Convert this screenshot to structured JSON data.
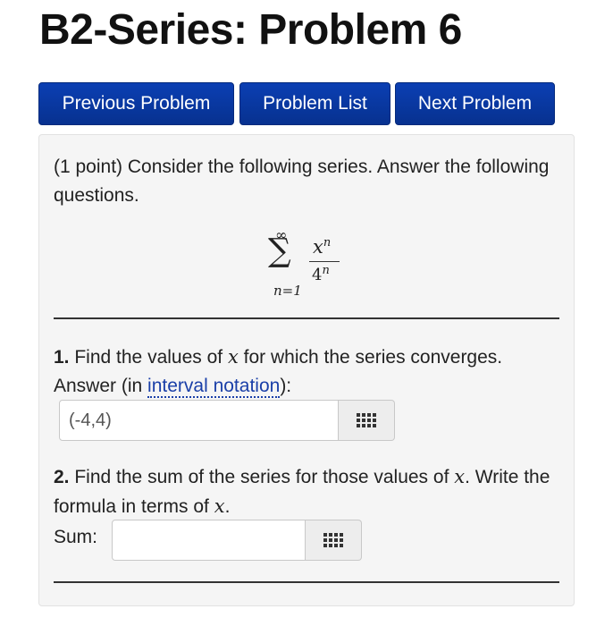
{
  "page_title": "B2-Series: Problem 6",
  "nav": {
    "previous": "Previous Problem",
    "list": "Problem List",
    "next": "Next Problem"
  },
  "problem": {
    "points": "(1 point)",
    "intro": "Consider the following series. Answer the following questions.",
    "series": {
      "upper_limit": "∞",
      "lower_limit": "n=1",
      "numerator_base": "x",
      "denominator_base": "4",
      "exponent": "n"
    },
    "q1": {
      "number": "1.",
      "text_before_var": "Find the values of",
      "var": "x",
      "text_after_var": "for which the series converges.",
      "answer_prefix": "Answer (in",
      "help_link": "interval notation",
      "answer_suffix": "):",
      "input_value": "(-4,4)"
    },
    "q2": {
      "number": "2.",
      "text_before_var": "Find the sum of the series for those values of",
      "var": "x",
      "text_middle": ". Write the formula in terms of",
      "var2": "x",
      "text_end": ".",
      "sum_label": "Sum:",
      "input_value": ""
    }
  },
  "icons": {
    "palette": "equation-palette-icon"
  },
  "colors": {
    "nav_button": "#0b3fb3",
    "link": "#1a3fa8",
    "panel_bg": "#f5f5f5"
  }
}
